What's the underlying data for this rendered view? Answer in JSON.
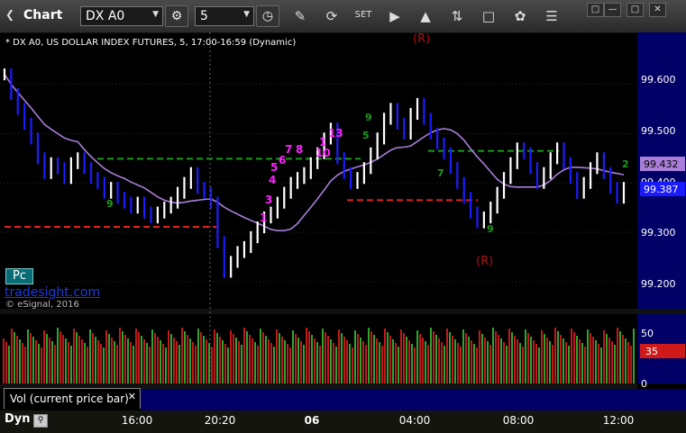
{
  "toolbar": {
    "title": "Chart",
    "symbol": "DX A0",
    "interval": "5",
    "icons": [
      "gear-icon",
      "clock-icon",
      "pen-icon",
      "refresh-icon",
      "settings-icon",
      "play-icon",
      "alert-icon",
      "link-icon",
      "comment-icon",
      "twitter-icon",
      "menu-icon"
    ]
  },
  "chart_header": "* DX A0, US DOLLAR INDEX FUTURES, 5, 17:00-16:59 (Dynamic)",
  "watermark": {
    "brand": "tradesight.com",
    "copyright": "© eSignal, 2016",
    "badge": "Pc"
  },
  "markers": {
    "r_top": "(R)",
    "r_bottom": "(R)"
  },
  "price_axis": {
    "ticks": [
      "99.600",
      "99.500",
      "99.400",
      "99.300",
      "99.200"
    ],
    "last_price": "99.387",
    "ma_value": "99.432"
  },
  "volume_axis": {
    "ticks": [
      "50",
      "0"
    ],
    "current": "35"
  },
  "volume_label": "Vol (current price bar)",
  "bottom": {
    "mode": "Dyn",
    "times": [
      "16:00",
      "20:20",
      "06",
      "04:00",
      "08:00",
      "12:00"
    ]
  },
  "td_counts": [
    {
      "t": "9",
      "color": "green"
    },
    {
      "t": "1",
      "color": "magenta"
    },
    {
      "t": "3",
      "color": "magenta"
    },
    {
      "t": "4",
      "color": "magenta"
    },
    {
      "t": "5",
      "color": "magenta"
    },
    {
      "t": "6",
      "color": "magenta"
    },
    {
      "t": "7",
      "color": "magenta"
    },
    {
      "t": "8",
      "color": "magenta"
    },
    {
      "t": "10",
      "color": "magenta"
    },
    {
      "t": "1",
      "color": "magenta"
    },
    {
      "t": "13",
      "color": "magenta"
    },
    {
      "t": "9",
      "color": "green"
    },
    {
      "t": "5",
      "color": "green"
    },
    {
      "t": "7",
      "color": "green"
    },
    {
      "t": "9",
      "color": "green"
    },
    {
      "t": "2",
      "color": "green"
    }
  ],
  "colors": {
    "background": "#000000",
    "up_bar": "#ffffff",
    "down_bar": "#1c1cff",
    "moving_average": "#a87ed8",
    "resistance": "#1d9a1d",
    "support": "#e02222",
    "volume_up": "#2fa52f",
    "volume_down": "#c01a1a",
    "axis_panel": "#000066",
    "td_setup": "#ff22ff"
  },
  "chart_data": {
    "type": "line",
    "ylim": [
      99.145,
      99.705
    ],
    "levels": {
      "resistance": [
        99.449,
        99.465
      ],
      "support": [
        99.311,
        99.365
      ]
    },
    "series": [
      {
        "values": [
          99.62,
          99.58,
          99.55,
          99.52,
          99.49,
          99.45,
          99.42,
          99.44,
          99.43,
          99.41,
          99.44,
          99.45,
          99.43,
          99.41,
          99.4,
          99.38,
          99.39,
          99.37,
          99.36,
          99.35,
          99.36,
          99.34,
          99.33,
          99.34,
          99.35,
          99.36,
          99.38,
          99.4,
          99.42,
          99.39,
          99.38,
          99.36,
          99.28,
          99.22,
          99.24,
          99.26,
          99.27,
          99.29,
          99.31,
          99.33,
          99.34,
          99.36,
          99.38,
          99.4,
          99.41,
          99.42,
          99.44,
          99.46,
          99.49,
          99.51,
          99.45,
          99.42,
          99.4,
          99.41,
          99.43,
          99.46,
          99.49,
          99.53,
          99.55,
          99.52,
          99.5,
          99.54,
          99.56,
          99.53,
          99.5,
          99.48,
          99.46,
          99.43,
          99.4,
          99.37,
          99.34,
          99.32,
          99.33,
          99.35,
          99.38,
          99.41,
          99.44,
          99.47,
          99.46,
          99.43,
          99.4,
          99.42,
          99.45,
          99.47,
          99.44,
          99.41,
          99.38,
          99.4,
          99.43,
          99.45,
          99.42,
          99.39,
          99.37,
          99.39
        ]
      }
    ]
  }
}
